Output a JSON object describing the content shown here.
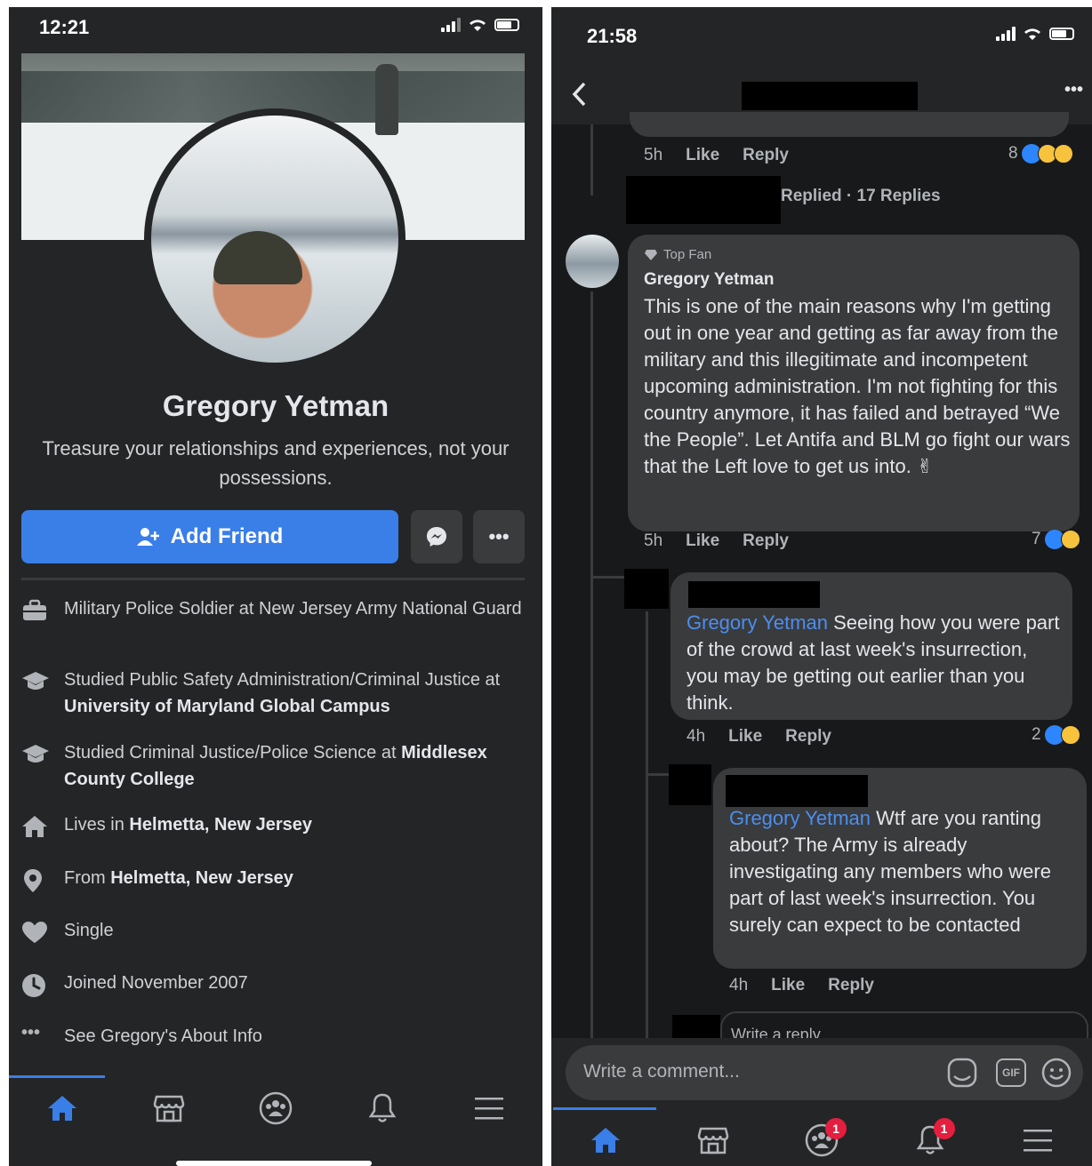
{
  "left": {
    "status": {
      "time": "12:21"
    },
    "profile": {
      "name": "Gregory Yetman",
      "bio": "Treasure your relationships and experiences, not your possessions.",
      "add_friend_label": "Add Friend",
      "more_label": "•••"
    },
    "info": [
      {
        "icon": "work-icon",
        "pre": "Military Police Soldier at New Jersey Army National Guard",
        "bold": ""
      },
      {
        "icon": "education-icon",
        "pre": "Studied Public Safety Administration/Criminal Justice at ",
        "bold": "University of Maryland Global Campus"
      },
      {
        "icon": "education-icon",
        "pre": "Studied Criminal Justice/Police Science at ",
        "bold": "Middlesex County College"
      },
      {
        "icon": "home-icon",
        "pre": "Lives in ",
        "bold": "Helmetta, New Jersey"
      },
      {
        "icon": "location-pin-icon",
        "pre": "From ",
        "bold": "Helmetta, New Jersey"
      },
      {
        "icon": "heart-icon",
        "pre": "Single",
        "bold": ""
      },
      {
        "icon": "clock-icon",
        "pre": "Joined November 2007",
        "bold": ""
      },
      {
        "icon": "more-dots-icon",
        "pre": "See Gregory's About Info",
        "bold": ""
      }
    ]
  },
  "right": {
    "status": {
      "time": "21:58"
    },
    "c0": {
      "time": "5h",
      "like": "Like",
      "reply": "Reply",
      "reactions": "8"
    },
    "replied": "Replied · 17 Replies",
    "c1": {
      "badge": "Top Fan",
      "author": "Gregory Yetman",
      "text": "This is one of the main reasons why I'm getting out in one year and getting as far away from the military and this illegitimate and incompetent upcoming administration. I'm not fighting for this country anymore, it has failed and betrayed “We the People”. Let Antifa and BLM go fight our wars that the Left love to get us into. ✌",
      "time": "5h",
      "like": "Like",
      "reply": "Reply",
      "reactions": "7"
    },
    "c2": {
      "mention": "Gregory Yetman",
      "text": " Seeing how you were part of the crowd at last week's insurrection, you may be getting out earlier than you think.",
      "time": "4h",
      "like": "Like",
      "reply": "Reply",
      "reactions": "2"
    },
    "c3": {
      "mention": "Gregory Yetman",
      "text": " Wtf are you ranting about?  The Army is already investigating any members who were part of last week's insurrection.  You surely can expect to be contacted",
      "time": "4h",
      "like": "Like",
      "reply": "Reply"
    },
    "write_reply": "Write a reply...",
    "comment_placeholder": "Write a comment...",
    "gif_label": "GIF",
    "groups_badge": "1",
    "notif_badge": "1"
  }
}
